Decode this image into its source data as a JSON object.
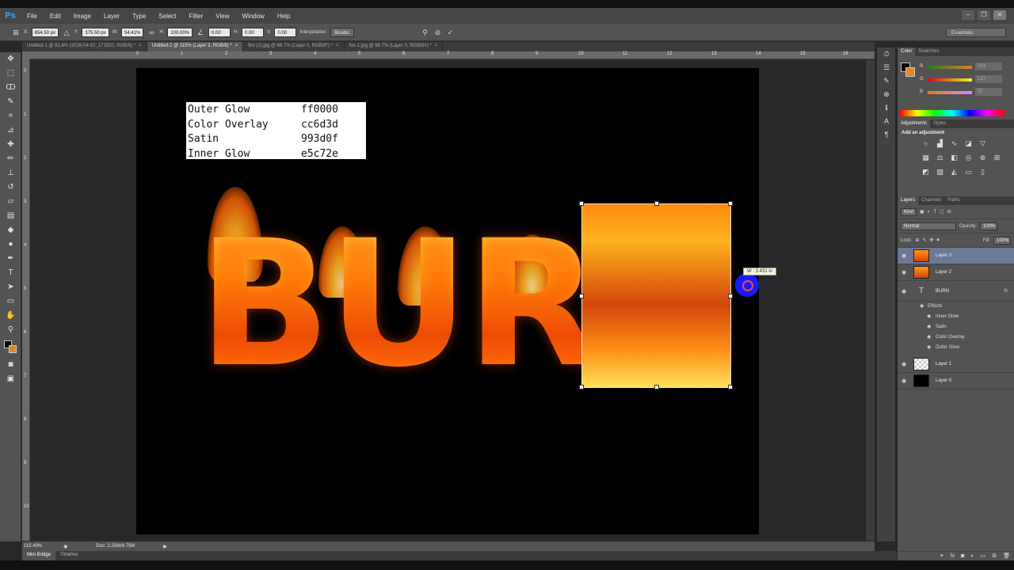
{
  "app": {
    "logo": "Ps"
  },
  "menu": [
    "File",
    "Edit",
    "Image",
    "Layer",
    "Type",
    "Select",
    "Filter",
    "View",
    "Window",
    "Help"
  ],
  "window_controls": [
    "–",
    "❐",
    "✕"
  ],
  "options_bar": {
    "x_label": "X:",
    "x_value": "854.50 px",
    "y_label": "Y:",
    "y_value": "375.50 px",
    "w_label": "W:",
    "w_value": "54.41%",
    "h_label": "H:",
    "h_value": "100.00%",
    "angle_value": "0.00",
    "hskew_label": "H:",
    "hskew_value": "0.00",
    "vskew_label": "V:",
    "vskew_value": "0.00",
    "interp_label": "Interpolation:",
    "interp_value": "Bicubic",
    "workspace": "Essentials"
  },
  "tabs": [
    {
      "label": "Untitled-1 @ 81.4% (2016-04-02_171920, RGB/8) *",
      "active": false
    },
    {
      "label": "Untitled-2 @ 115% (Layer 3, RGB/8) *",
      "active": true
    },
    {
      "label": "fire (1).jpg @ 66.7% (Layer 0, RGB/8*) *",
      "active": false
    },
    {
      "label": "fire-1.jpg @ 66.7% (Layer 0, RGB/8#) *",
      "active": false
    }
  ],
  "ruler_top": [
    "0",
    "1",
    "2",
    "3",
    "4",
    "5",
    "6",
    "7",
    "8",
    "9",
    "10",
    "11",
    "12",
    "13",
    "14",
    "15",
    "16"
  ],
  "ruler_left": [
    "0",
    "1",
    "2",
    "3",
    "4",
    "5",
    "6",
    "7",
    "8",
    "9",
    "10"
  ],
  "canvas": {
    "ref_table": [
      {
        "name": "Outer Glow",
        "code": "ff0000"
      },
      {
        "name": "Color Overlay",
        "code": "cc6d3d"
      },
      {
        "name": "Satin",
        "code": "993d0f"
      },
      {
        "name": "Inner Glow",
        "code": "e5c72e"
      }
    ],
    "fire_text": "BURN",
    "transform_tip": "W : 3.431 in"
  },
  "status": {
    "zoom": "115.49%",
    "doc": "Doc: 2.25M/6.75M"
  },
  "bottom_tabs": [
    "Mini Bridge",
    "Timeline"
  ],
  "panels": {
    "color_tabs": [
      "Color",
      "Swatches"
    ],
    "channels": [
      {
        "label": "R",
        "value": "224"
      },
      {
        "label": "G",
        "value": "127"
      },
      {
        "label": "B",
        "value": "37"
      }
    ],
    "adj_tabs": [
      "Adjustments",
      "Styles"
    ],
    "adj_title": "Add an adjustment",
    "layers_tabs": [
      "Layers",
      "Channels",
      "Paths"
    ],
    "kind_label": "Kind",
    "blend_mode": "Normal",
    "opacity_label": "Opacity:",
    "opacity_value": "100%",
    "lock_label": "Lock:",
    "fill_label": "Fill:",
    "fill_value": "100%",
    "layers": [
      {
        "name": "Layer 3",
        "selected": true
      },
      {
        "name": "Layer 2",
        "selected": false
      },
      {
        "name": "BURN",
        "selected": false,
        "fx": "fx"
      }
    ],
    "effects_header": "Effects",
    "effects": [
      "Inner Glow",
      "Satin",
      "Color Overlay",
      "Outer Glow"
    ],
    "layers_bottom": [
      {
        "name": "Layer 1"
      },
      {
        "name": "Layer 0"
      }
    ]
  },
  "colors": {
    "accent": "#31a8ff",
    "foreground": "#000000",
    "background": "#e5842c",
    "selection": "#6b7996"
  }
}
